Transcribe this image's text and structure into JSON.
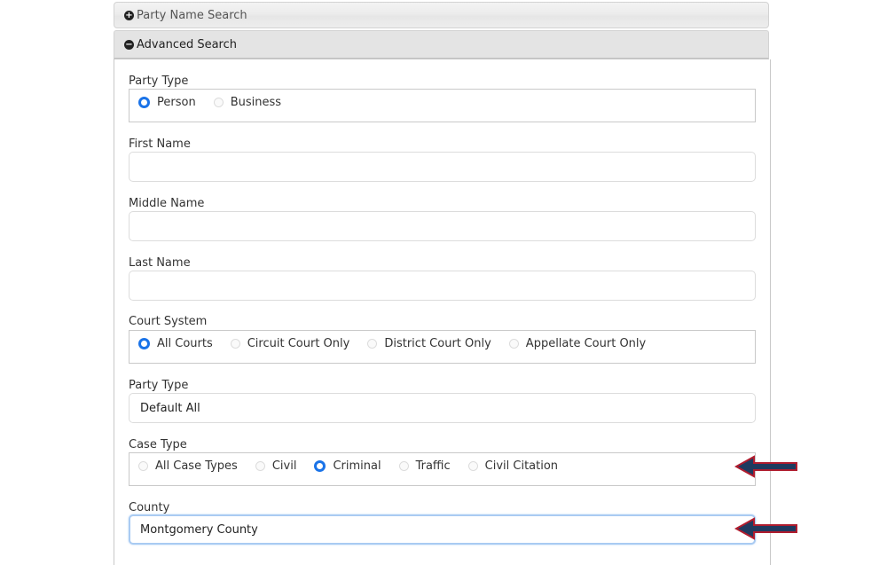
{
  "accordion": {
    "party_name_search": {
      "label": "Party Name Search",
      "icon": "plus-circle-icon",
      "expanded": false
    },
    "advanced_search": {
      "label": "Advanced Search",
      "icon": "minus-circle-icon",
      "expanded": true
    }
  },
  "form": {
    "party_type": {
      "label": "Party Type",
      "options": [
        {
          "label": "Person",
          "checked": true
        },
        {
          "label": "Business",
          "checked": false
        }
      ]
    },
    "first_name": {
      "label": "First Name",
      "value": ""
    },
    "middle_name": {
      "label": "Middle Name",
      "value": ""
    },
    "last_name": {
      "label": "Last Name",
      "value": ""
    },
    "court_system": {
      "label": "Court System",
      "options": [
        {
          "label": "All Courts",
          "checked": true
        },
        {
          "label": "Circuit Court Only",
          "checked": false
        },
        {
          "label": "District Court Only",
          "checked": false
        },
        {
          "label": "Appellate Court Only",
          "checked": false
        }
      ]
    },
    "party_type_select": {
      "label": "Party Type",
      "value": "Default All"
    },
    "case_type": {
      "label": "Case Type",
      "options": [
        {
          "label": "All Case Types",
          "checked": false
        },
        {
          "label": "Civil",
          "checked": false
        },
        {
          "label": "Criminal",
          "checked": true
        },
        {
          "label": "Traffic",
          "checked": false
        },
        {
          "label": "Civil Citation",
          "checked": false
        }
      ]
    },
    "county": {
      "label": "County",
      "value": "Montgomery County"
    }
  },
  "annotations": {
    "arrow_color": "#1f3a5f",
    "arrow_outline": "#b01c2e",
    "targets": [
      "case-type",
      "county"
    ]
  },
  "colors": {
    "radio_checked": "#1a73e8",
    "focus_border": "#a9cbf2"
  }
}
